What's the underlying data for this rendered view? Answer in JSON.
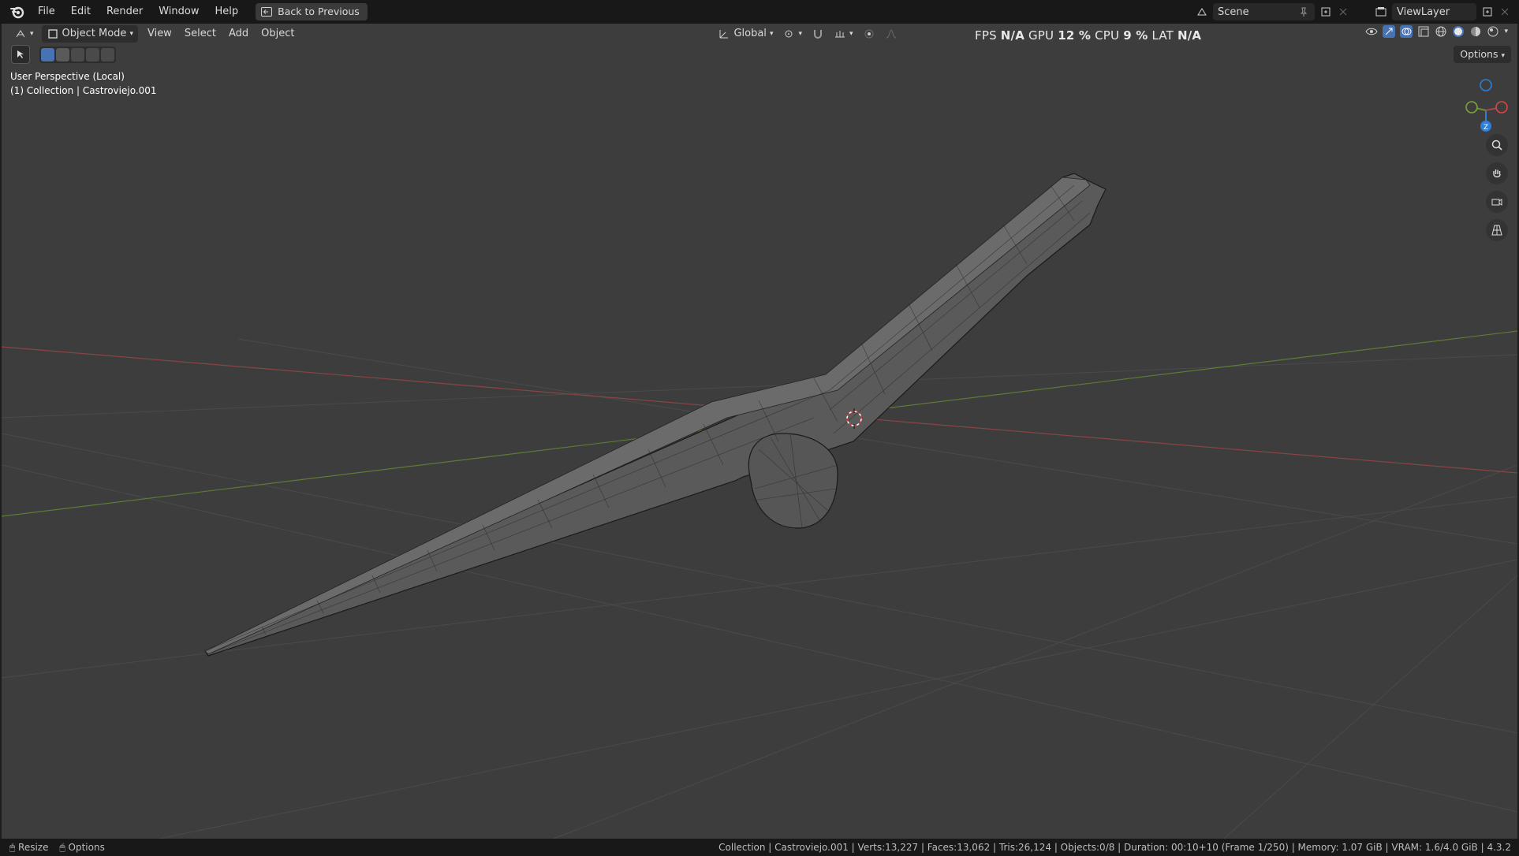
{
  "menu": {
    "items": [
      "File",
      "Edit",
      "Render",
      "Window",
      "Help"
    ],
    "back_label": "Back to Previous"
  },
  "topright": {
    "scene": "Scene",
    "viewlayer": "ViewLayer"
  },
  "header": {
    "mode": "Object Mode",
    "view": "View",
    "select": "Select",
    "add": "Add",
    "object": "Object",
    "orientation": "Global",
    "options": "Options"
  },
  "perf": {
    "fps_label": "FPS",
    "fps": "N/A",
    "gpu_label": "GPU",
    "gpu": "12 %",
    "cpu_label": "CPU",
    "cpu": "9 %",
    "lat_label": "LAT",
    "lat": "N/A"
  },
  "viewport": {
    "perspective": "User Perspective (Local)",
    "collection": "(1) Collection | Castroviejo.001",
    "gizmo_z": "Z"
  },
  "status": {
    "resize": "Resize",
    "options": "Options",
    "info": "Collection | Castroviejo.001 | Verts:13,227 | Faces:13,062 | Tris:26,124 | Objects:0/8 | Duration: 00:10+10 (Frame 1/250) | Memory: 1.07 GiB | VRAM: 1.6/4.0 GiB | 4.3.2"
  },
  "colors": {
    "accent": "#4772b3",
    "x_axis": "#a34848",
    "y_axis": "#6b8a3a",
    "z_axis": "#2f7fd6"
  }
}
